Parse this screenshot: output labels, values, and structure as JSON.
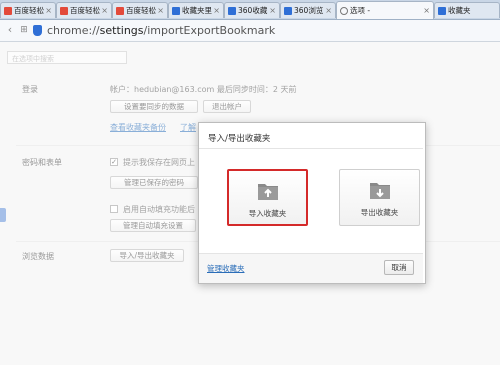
{
  "tabs": [
    {
      "title": "百度轻松",
      "icon": "baidu-paw-icon",
      "active": false
    },
    {
      "title": "百度轻松",
      "icon": "baidu-paw-icon",
      "active": false
    },
    {
      "title": "百度轻松",
      "icon": "baidu-paw-icon",
      "active": false
    },
    {
      "title": "收藏夹里",
      "icon": "page-icon",
      "active": false
    },
    {
      "title": "360收藏",
      "icon": "page-icon",
      "active": false
    },
    {
      "title": "360浏览",
      "icon": "page-icon",
      "active": false
    },
    {
      "title": "选项 - ",
      "icon": "gear-icon",
      "active": true
    },
    {
      "title": "收藏夹",
      "icon": "page-icon",
      "active": false
    }
  ],
  "toolbar": {
    "url_scheme": "chrome://",
    "url_host": "settings",
    "url_path": "/importExportBookmark"
  },
  "search": {
    "placeholder": "在选项中搜索"
  },
  "sections": {
    "login": {
      "title": "登录",
      "account_text": "帐户：hedubian@163.com  最后同步时间：2 天前",
      "sync_button": "设置要同步的数据",
      "logout_button": "退出帐户",
      "backup_link": "查看收藏夹备份",
      "learn_more_link": "了解"
    },
    "passwords": {
      "title": "密码和表单",
      "save_password_checkbox": "提示我保存在网页上",
      "manage_passwords_button": "管理已保存的密码",
      "autofill_checkbox": "启用自动填充功能后",
      "autofill_button": "管理自动填充设置"
    },
    "browsing": {
      "title": "浏览数据",
      "import_export_button": "导入/导出收藏夹"
    }
  },
  "dialog": {
    "title": "导入/导出收藏夹",
    "import_label": "导入收藏夹",
    "export_label": "导出收藏夹",
    "manage_link": "管理收藏夹",
    "cancel_button": "取消"
  },
  "colors": {
    "selection_border": "#d42a2a",
    "link": "#2a6db8",
    "folder": "#8a8a8a"
  }
}
